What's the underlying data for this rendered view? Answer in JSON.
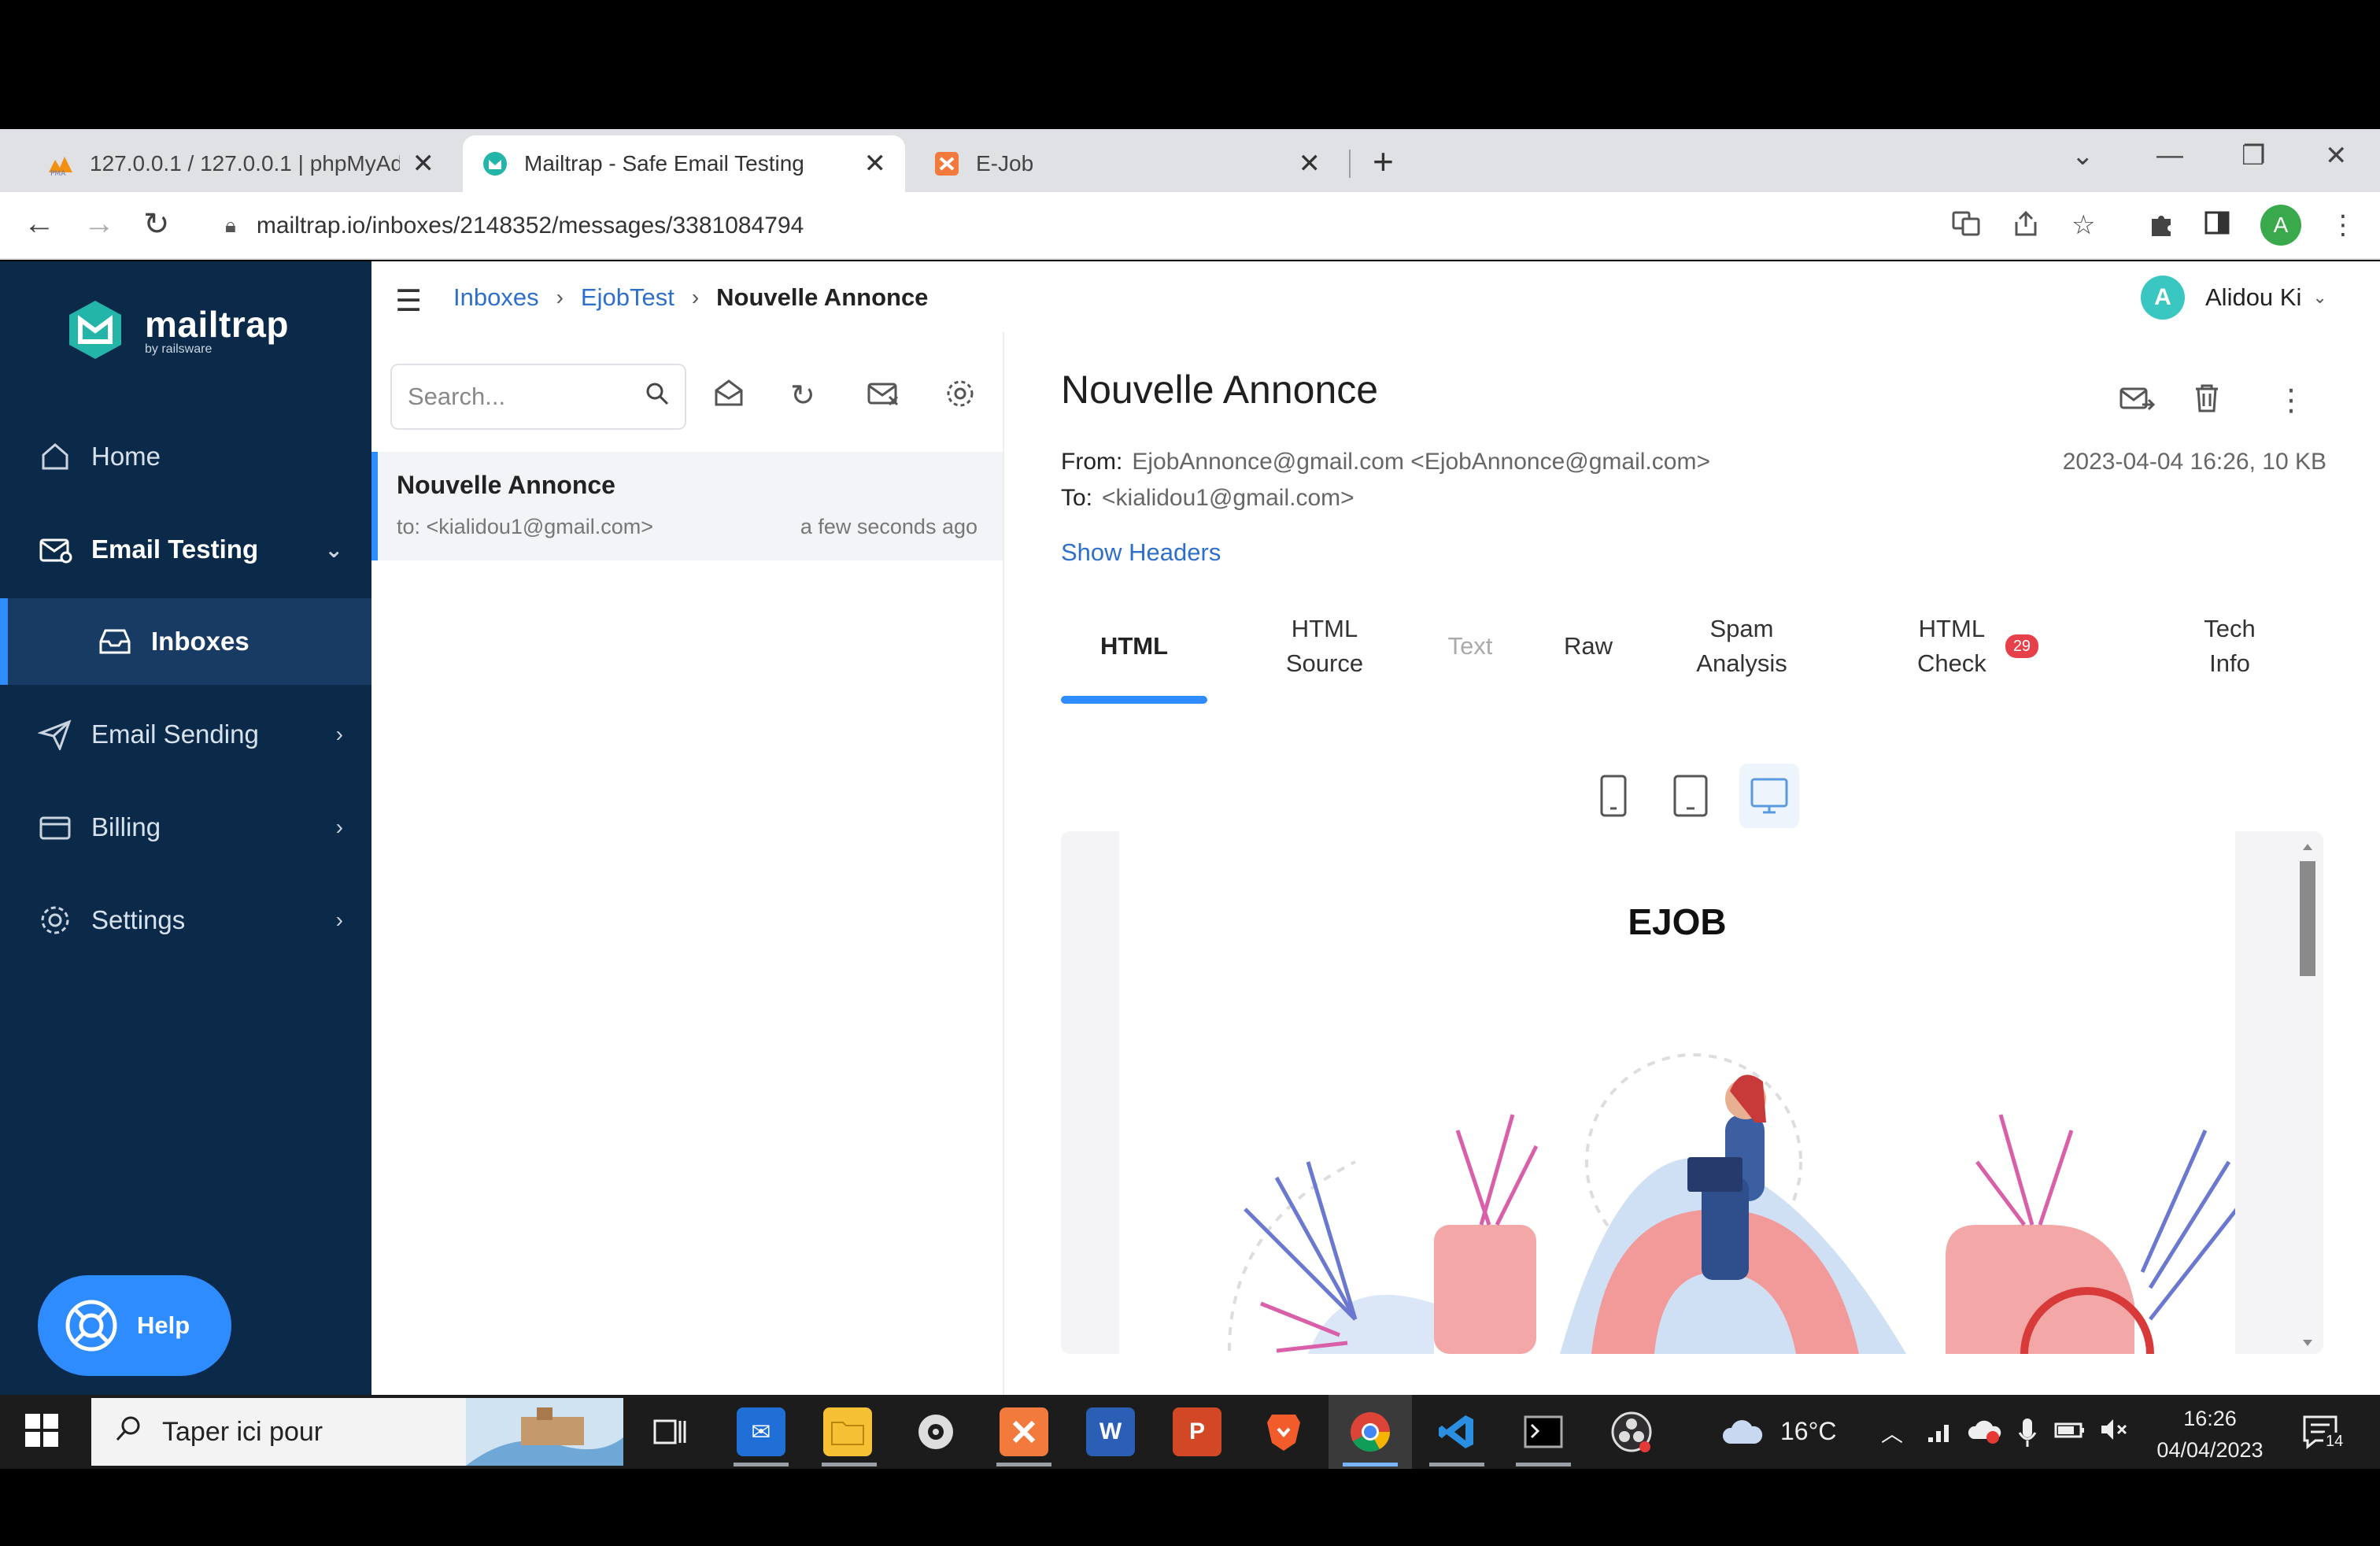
{
  "browser": {
    "tabs": [
      {
        "title": "127.0.0.1 / 127.0.0.1 | phpMyAdmin",
        "favicon": "phpmyadmin-icon",
        "active": false
      },
      {
        "title": "Mailtrap - Safe Email Testing",
        "favicon": "mailtrap-icon",
        "active": true
      },
      {
        "title": "E-Job",
        "favicon": "ejob-icon",
        "active": false
      }
    ],
    "url": "mailtrap.io/inboxes/2148352/messages/3381084794",
    "profile_initial": "A"
  },
  "app": {
    "logo": {
      "name": "mailtrap",
      "sub": "by railsware"
    },
    "sidebar": [
      {
        "label": "Home",
        "icon": "home-icon"
      },
      {
        "label": "Email Testing",
        "icon": "email-testing-icon"
      },
      {
        "label": "Inboxes",
        "icon": "inbox-icon"
      },
      {
        "label": "Email Sending",
        "icon": "send-icon"
      },
      {
        "label": "Billing",
        "icon": "billing-icon"
      },
      {
        "label": "Settings",
        "icon": "gear-icon"
      }
    ],
    "help_label": "Help",
    "breadcrumb": [
      "Inboxes",
      "EjobTest",
      "Nouvelle Annonce"
    ],
    "user": {
      "initial": "A",
      "name": "Alidou Ki"
    },
    "search_placeholder": "Search...",
    "messages": [
      {
        "subject": "Nouvelle Annonce",
        "to": "to: <kialidou1@gmail.com>",
        "time": "a few seconds ago"
      }
    ],
    "detail": {
      "subject": "Nouvelle Annonce",
      "from_label": "From:",
      "from": "EjobAnnonce@gmail.com <EjobAnnonce@gmail.com>",
      "to_label": "To:",
      "to": "<kialidou1@gmail.com>",
      "date": "2023-04-04 16:26, 10 KB",
      "show_headers": "Show Headers",
      "tabs": [
        {
          "label": "HTML"
        },
        {
          "label": "HTML\nSource"
        },
        {
          "label": "Text"
        },
        {
          "label": "Raw"
        },
        {
          "label": "Spam\nAnalysis"
        },
        {
          "label": "HTML\nCheck",
          "badge": "29"
        },
        {
          "label": "Tech\nInfo"
        }
      ],
      "preview_title": "EJOB"
    }
  },
  "taskbar": {
    "search_placeholder": "Taper ici pour",
    "weather": "16°C",
    "time": "16:26",
    "date": "04/04/2023",
    "notifications": "14"
  },
  "colors": {
    "sidebar_bg": "#0b2a4a",
    "accent": "#2f8cff",
    "link": "#2f6fcc",
    "badge": "#e6404a"
  }
}
